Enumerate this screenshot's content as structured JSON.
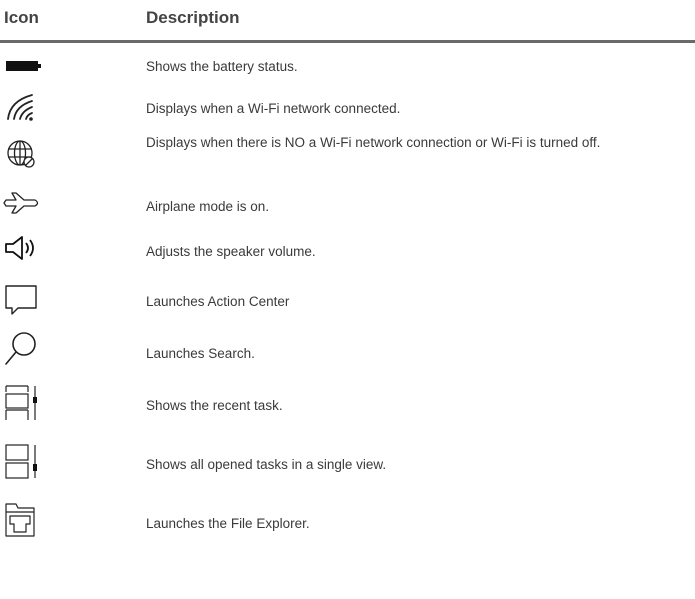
{
  "header": {
    "icon_col": "Icon",
    "desc_col": "Description"
  },
  "rows": [
    {
      "icon": "battery-icon",
      "description": "Shows the battery status."
    },
    {
      "icon": "wifi-icon",
      "description": "Displays when a Wi-Fi network connected."
    },
    {
      "icon": "globe-no-network-icon",
      "description": "Displays when there is NO a Wi-Fi network connection or Wi-Fi is turned off."
    },
    {
      "icon": "airplane-icon",
      "description": "Airplane mode is on."
    },
    {
      "icon": "speaker-volume-icon",
      "description": "Adjusts the speaker volume."
    },
    {
      "icon": "action-center-icon",
      "description": "Launches Action Center"
    },
    {
      "icon": "search-icon",
      "description": "Launches Search."
    },
    {
      "icon": "recent-task-icon",
      "description": "Shows the recent task."
    },
    {
      "icon": "task-view-icon",
      "description": "Shows all opened tasks in a single view."
    },
    {
      "icon": "file-explorer-icon",
      "description": "Launches the File Explorer."
    }
  ]
}
